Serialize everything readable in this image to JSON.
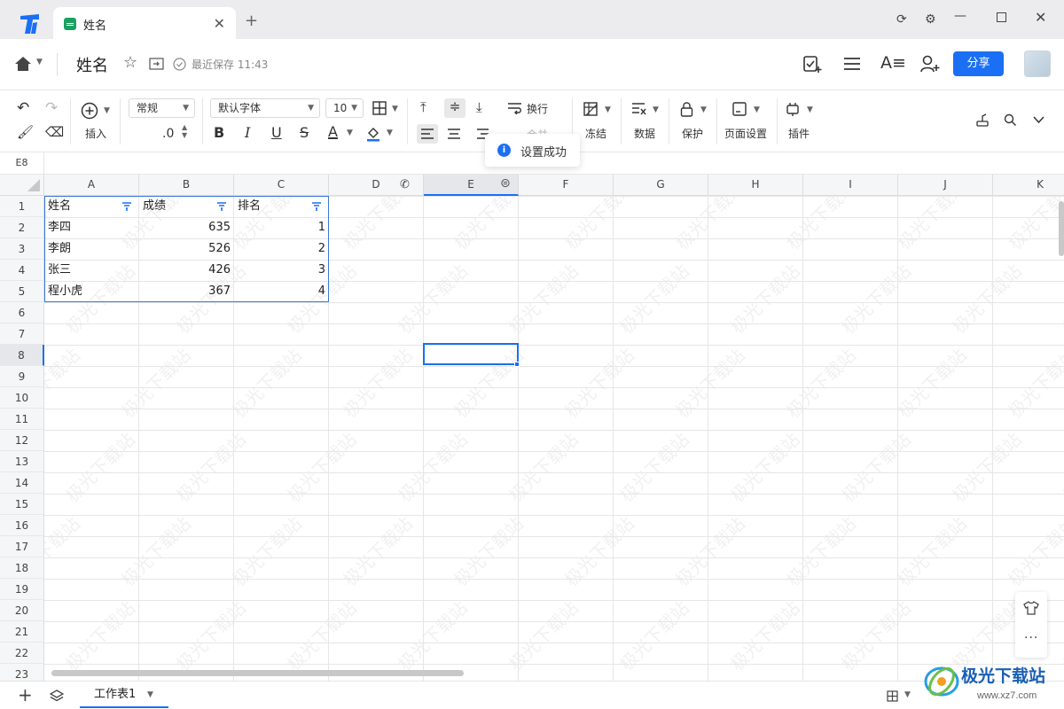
{
  "app": {
    "tab_title": "姓名",
    "new_tab": "+"
  },
  "header": {
    "doc_title": "姓名",
    "save_status": "最近保存 11:43",
    "share_label": "分享"
  },
  "toolbar": {
    "insert_label": "插入",
    "number_format": "常规",
    "decimal_label": ".0",
    "font_family": "默认字体",
    "font_size": "10",
    "wrap_label": "换行",
    "merge_label": "合并",
    "freeze_label": "冻结",
    "data_label": "数据",
    "protect_label": "保护",
    "page_setup_label": "页面设置",
    "plugin_label": "插件",
    "bold": "B",
    "italic": "I",
    "underline": "U",
    "strike": "S",
    "font_color": "A"
  },
  "toast": {
    "text": "设置成功"
  },
  "formula": {
    "cell_ref": "E8"
  },
  "sheet": {
    "columns": [
      "A",
      "B",
      "C",
      "D",
      "E",
      "F",
      "G",
      "H",
      "I",
      "J",
      "K"
    ],
    "rows": [
      "1",
      "2",
      "3",
      "4",
      "5",
      "6",
      "7",
      "8",
      "9",
      "10",
      "11",
      "12",
      "13",
      "14",
      "15",
      "16",
      "17",
      "18",
      "19",
      "20",
      "21",
      "22",
      "23"
    ],
    "table": {
      "headers": [
        "姓名",
        "成绩",
        "排名"
      ],
      "rows": [
        [
          "李四",
          "635",
          "1"
        ],
        [
          "李朗",
          "526",
          "2"
        ],
        [
          "张三",
          "426",
          "3"
        ],
        [
          "程小虎",
          "367",
          "4"
        ]
      ]
    },
    "watermark": "极光下载站"
  },
  "footer": {
    "sheet_name": "工作表1",
    "brand": "极光下载站",
    "brand_url": "www.xz7.com"
  },
  "colors": {
    "accent": "#1a6ff5",
    "filter": "#1a6ff5",
    "spreadsheet_icon": "#1aa160"
  }
}
